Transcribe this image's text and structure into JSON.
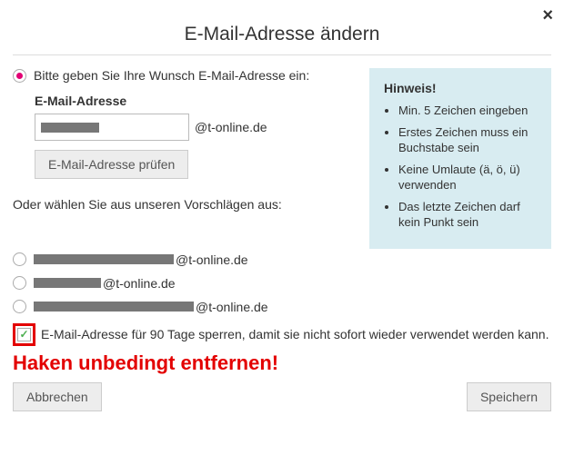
{
  "dialog": {
    "title": "E-Mail-Adresse ändern",
    "close_glyph": "×"
  },
  "option_custom": {
    "label": "Bitte geben Sie Ihre Wunsch E-Mail-Adresse ein:",
    "field_label": "E-Mail-Adresse",
    "domain_suffix": "@t-online.de",
    "check_button": "E-Mail-Adresse prüfen"
  },
  "or_text": "Oder wählen Sie aus unseren Vorschlägen aus:",
  "suggestions": [
    {
      "domain": "@t-online.de",
      "redact_w": 154
    },
    {
      "domain": "@t-online.de",
      "redact_w": 74
    },
    {
      "domain": "@t-online.de",
      "redact_w": 176
    }
  ],
  "hint": {
    "title": "Hinweis!",
    "items": [
      "Min. 5 Zeichen eingeben",
      "Erstes Zeichen muss ein Buchstabe sein",
      "Keine Umlaute (ä, ö, ü) verwenden",
      "Das letzte Zeichen darf kein Punkt sein"
    ]
  },
  "lock": {
    "checkmark": "✓",
    "label": "E-Mail-Adresse für 90 Tage sperren, damit sie nicht sofort wieder verwendet werden kann."
  },
  "alert": "Haken unbedingt entfernen!",
  "buttons": {
    "cancel": "Abbrechen",
    "save": "Speichern"
  },
  "input_redact_w": 64
}
